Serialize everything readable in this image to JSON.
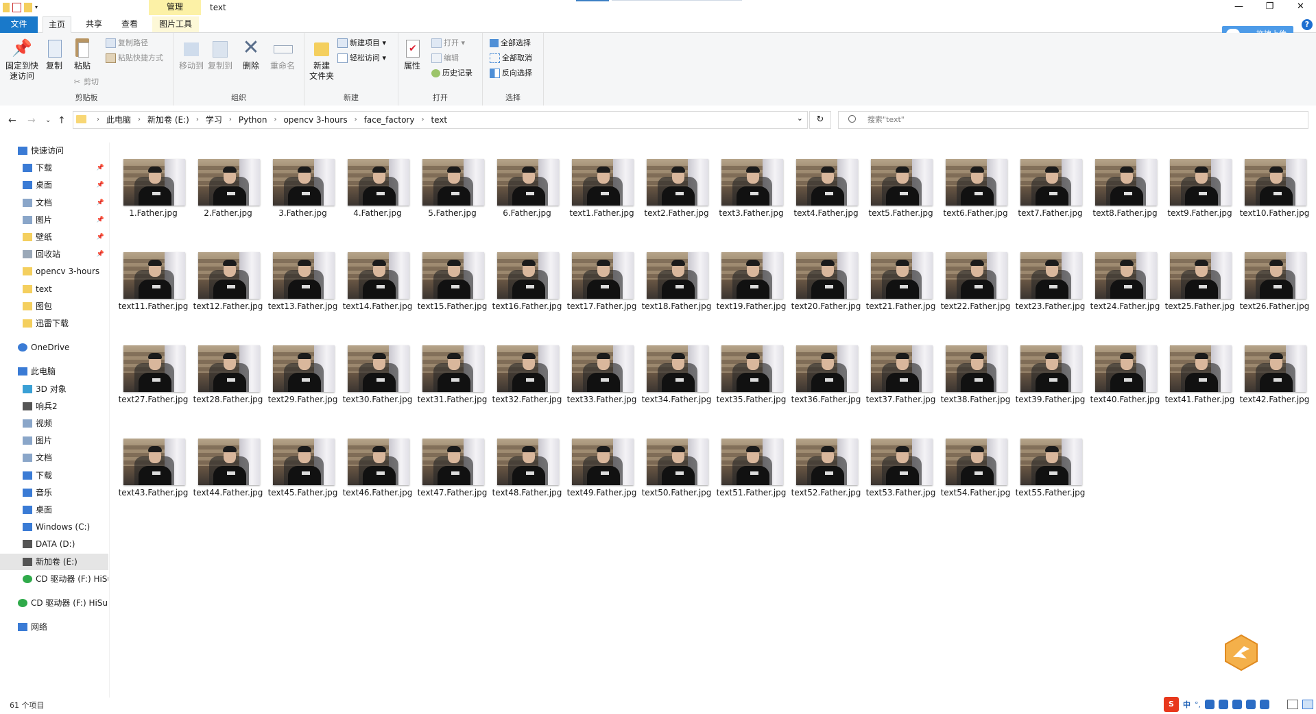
{
  "window": {
    "title": "text",
    "context_tab": "管理",
    "min": "—",
    "max": "❐",
    "close": "✕"
  },
  "tabs": {
    "file": "文件",
    "home": "主页",
    "share": "共享",
    "view": "查看",
    "picture_tools": "图片工具"
  },
  "upload_button": "拖拽上传",
  "help": "?",
  "ribbon": {
    "clipboard": {
      "label": "剪贴板",
      "pin": "固定到快\n速访问",
      "copy": "复制",
      "paste": "粘贴",
      "copy_path": "复制路径",
      "paste_shortcut": "粘贴快捷方式",
      "cut": "剪切"
    },
    "organize": {
      "label": "组织",
      "move_to": "移动到",
      "copy_to": "复制到",
      "delete": "删除",
      "rename": "重命名"
    },
    "new": {
      "label": "新建",
      "new_folder": "新建\n文件夹",
      "new_item": "新建项目",
      "easy_access": "轻松访问"
    },
    "open": {
      "label": "打开",
      "properties": "属性",
      "open": "打开",
      "edit": "编辑",
      "history": "历史记录"
    },
    "select": {
      "label": "选择",
      "select_all": "全部选择",
      "select_none": "全部取消",
      "invert": "反向选择"
    }
  },
  "address": {
    "crumbs": [
      "此电脑",
      "新加卷 (E:)",
      "学习",
      "Python",
      "opencv 3-hours",
      "face_factory",
      "text"
    ],
    "search_placeholder": "搜索\"text\""
  },
  "sidebar": [
    {
      "label": "快速访问",
      "icon": "star-icon",
      "pinned": false
    },
    {
      "label": "下载",
      "icon": "download-icon",
      "pinned": true
    },
    {
      "label": "桌面",
      "icon": "desktop-icon",
      "pinned": true
    },
    {
      "label": "文档",
      "icon": "document-icon",
      "pinned": true
    },
    {
      "label": "图片",
      "icon": "picture-icon",
      "pinned": true
    },
    {
      "label": "壁纸",
      "icon": "folder-icon",
      "pinned": true
    },
    {
      "label": "回收站",
      "icon": "recycle-bin-icon",
      "pinned": true
    },
    {
      "label": "opencv 3-hours",
      "icon": "folder-icon",
      "pinned": false
    },
    {
      "label": "text",
      "icon": "folder-icon",
      "pinned": false
    },
    {
      "label": "图包",
      "icon": "folder-icon",
      "pinned": false
    },
    {
      "label": "迅雷下载",
      "icon": "folder-icon",
      "pinned": false
    },
    {
      "label": "OneDrive",
      "icon": "cloud-icon",
      "pinned": false
    },
    {
      "label": "此电脑",
      "icon": "computer-icon",
      "pinned": false
    },
    {
      "label": "3D 对象",
      "icon": "3d-objects-icon",
      "pinned": false
    },
    {
      "label": "响兵2",
      "icon": "drive-icon",
      "pinned": false
    },
    {
      "label": "视频",
      "icon": "video-icon",
      "pinned": false
    },
    {
      "label": "图片",
      "icon": "picture-icon",
      "pinned": false
    },
    {
      "label": "文档",
      "icon": "document-icon",
      "pinned": false
    },
    {
      "label": "下载",
      "icon": "download-icon",
      "pinned": false
    },
    {
      "label": "音乐",
      "icon": "music-icon",
      "pinned": false
    },
    {
      "label": "桌面",
      "icon": "desktop-icon",
      "pinned": false
    },
    {
      "label": "Windows (C:)",
      "icon": "windows-drive-icon",
      "pinned": false
    },
    {
      "label": "DATA (D:)",
      "icon": "drive-icon",
      "pinned": false
    },
    {
      "label": "新加卷 (E:)",
      "icon": "drive-icon",
      "pinned": false
    },
    {
      "label": "CD 驱动器 (F:) HiSui",
      "icon": "cd-drive-icon",
      "pinned": false
    },
    {
      "label": "CD 驱动器 (F:) HiSui",
      "icon": "cd-drive-icon",
      "pinned": false
    },
    {
      "label": "网络",
      "icon": "network-icon",
      "pinned": false
    }
  ],
  "files": [
    "1.Father.jpg",
    "2.Father.jpg",
    "3.Father.jpg",
    "4.Father.jpg",
    "5.Father.jpg",
    "6.Father.jpg",
    "text1.Father.jpg",
    "text2.Father.jpg",
    "text3.Father.jpg",
    "text4.Father.jpg",
    "text5.Father.jpg",
    "text6.Father.jpg",
    "text7.Father.jpg",
    "text8.Father.jpg",
    "text9.Father.jpg",
    "text10.Father.jpg",
    "text11.Father.jpg",
    "text12.Father.jpg",
    "text13.Father.jpg",
    "text14.Father.jpg",
    "text15.Father.jpg",
    "text16.Father.jpg",
    "text17.Father.jpg",
    "text18.Father.jpg",
    "text19.Father.jpg",
    "text20.Father.jpg",
    "text21.Father.jpg",
    "text22.Father.jpg",
    "text23.Father.jpg",
    "text24.Father.jpg",
    "text25.Father.jpg",
    "text26.Father.jpg",
    "text27.Father.jpg",
    "text28.Father.jpg",
    "text29.Father.jpg",
    "text30.Father.jpg",
    "text31.Father.jpg",
    "text32.Father.jpg",
    "text33.Father.jpg",
    "text34.Father.jpg",
    "text35.Father.jpg",
    "text36.Father.jpg",
    "text37.Father.jpg",
    "text38.Father.jpg",
    "text39.Father.jpg",
    "text40.Father.jpg",
    "text41.Father.jpg",
    "text42.Father.jpg",
    "text43.Father.jpg",
    "text44.Father.jpg",
    "text45.Father.jpg",
    "text46.Father.jpg",
    "text47.Father.jpg",
    "text48.Father.jpg",
    "text49.Father.jpg",
    "text50.Father.jpg",
    "text51.Father.jpg",
    "text52.Father.jpg",
    "text53.Father.jpg",
    "text54.Father.jpg",
    "text55.Father.jpg"
  ],
  "status": {
    "item_count": "61 个项目"
  },
  "tray": {
    "ime": "中",
    "punct": "°,"
  },
  "colors": {
    "accent": "#1979ca",
    "context_tab": "#fcf1a6",
    "upload": "#4d9be8",
    "sogou": "#e8381c"
  }
}
